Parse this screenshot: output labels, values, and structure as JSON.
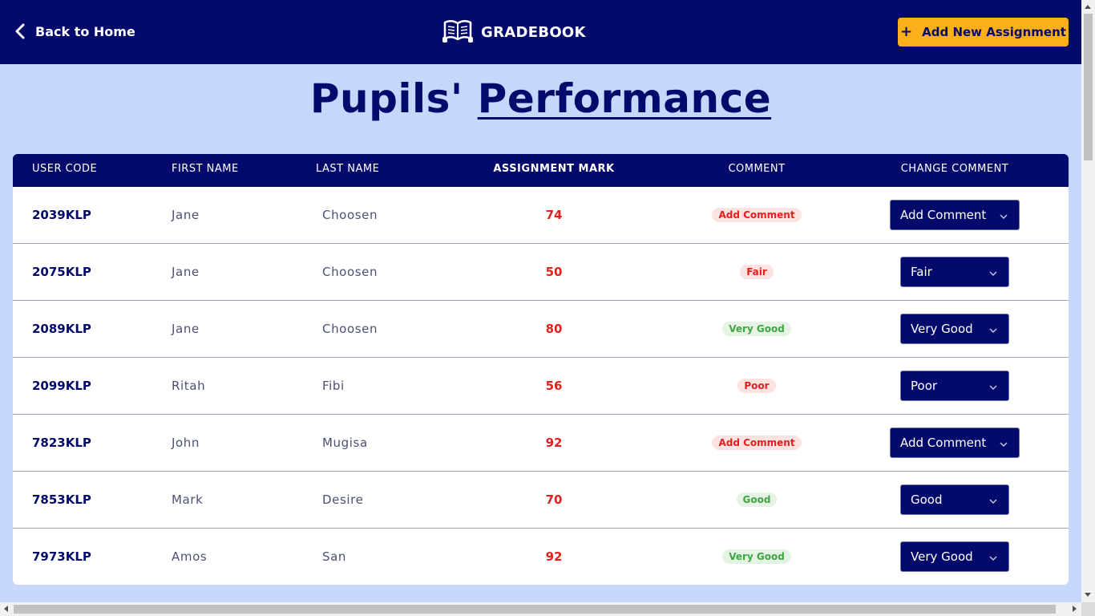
{
  "header": {
    "back_label": "Back to Home",
    "brand": "GRADEBOOK",
    "add_button_label": "Add New Assignment",
    "add_button_plus": "+"
  },
  "page": {
    "title_part1": "Pupils'",
    "title_part2": "Performance"
  },
  "table": {
    "columns": [
      "USER CODE",
      "FIRST NAME",
      "LAST NAME",
      "ASSIGNMENT MARK (%)",
      "COMMENT",
      "CHANGE COMMENT"
    ],
    "rows": [
      {
        "code": "2039KLP",
        "first": "Jane",
        "last": "Choosen",
        "mark": "74",
        "comment": "Add Comment",
        "change": "Add Comment"
      },
      {
        "code": "2075KLP",
        "first": "Jane",
        "last": "Choosen",
        "mark": "50",
        "comment": "Fair",
        "change": "Fair"
      },
      {
        "code": "2089KLP",
        "first": "Jane",
        "last": "Choosen",
        "mark": "80",
        "comment": "Very Good",
        "change": "Very Good"
      },
      {
        "code": "2099KLP",
        "first": "Ritah",
        "last": "Fibi",
        "mark": "56",
        "comment": "Poor",
        "change": "Poor"
      },
      {
        "code": "7823KLP",
        "first": "John",
        "last": "Mugisa",
        "mark": "92",
        "comment": "Add Comment",
        "change": "Add Comment"
      },
      {
        "code": "7853KLP",
        "first": "Mark",
        "last": "Desire",
        "mark": "70",
        "comment": "Good",
        "change": "Good"
      },
      {
        "code": "7973KLP",
        "first": "Amos",
        "last": "San",
        "mark": "92",
        "comment": "Very Good",
        "change": "Very Good"
      }
    ]
  },
  "colors": {
    "navy": "#030a6b",
    "page_bg": "#c7d6fb",
    "accent_orange": "#fbaf1b",
    "mark_red": "#e51e1e",
    "good_green": "#3fa543"
  },
  "icons": {
    "back": "chevron-left-icon",
    "brand": "open-book-icon",
    "select_caret": "chevron-down-icon"
  }
}
